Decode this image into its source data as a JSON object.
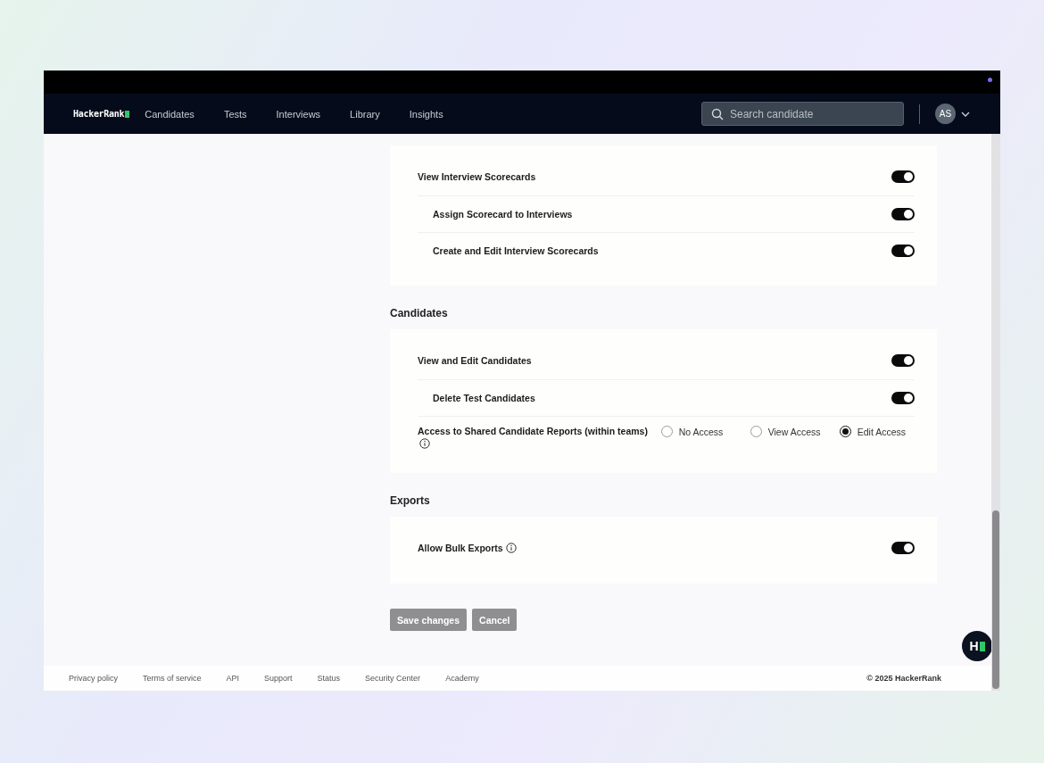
{
  "top_bar": {
    "notification_dot": true
  },
  "nav": {
    "logo": "HackerRank",
    "items": [
      {
        "label": "Candidates"
      },
      {
        "label": "Tests"
      },
      {
        "label": "Interviews"
      },
      {
        "label": "Library"
      },
      {
        "label": "Insights"
      }
    ],
    "search": {
      "placeholder": "Search candidate"
    },
    "avatar": "AS"
  },
  "sections": [
    {
      "rows": [
        {
          "kind": "toggle",
          "label": "View Interview Scorecards",
          "on": true,
          "children": [
            {
              "kind": "toggle",
              "label": "Assign Scorecard to Interviews",
              "on": true
            },
            {
              "kind": "toggle",
              "label": "Create and Edit Interview Scorecards",
              "on": true
            }
          ]
        }
      ]
    },
    {
      "title": "Candidates",
      "rows": [
        {
          "kind": "toggle",
          "label": "View and Edit Candidates",
          "on": true,
          "children": [
            {
              "kind": "toggle",
              "label": "Delete Test Candidates",
              "on": true
            }
          ]
        },
        {
          "kind": "radio",
          "label": "Access to Shared Candidate Reports (within teams)",
          "info_icon": true,
          "options": [
            {
              "label": "No Access",
              "selected": false
            },
            {
              "label": "View Access",
              "selected": false
            },
            {
              "label": "Edit Access",
              "selected": true
            }
          ]
        }
      ]
    },
    {
      "title": "Exports",
      "rows": [
        {
          "kind": "toggle",
          "label": "Allow Bulk Exports",
          "info_icon": true,
          "on": true
        }
      ]
    }
  ],
  "buttons": [
    {
      "label": "Save changes",
      "disabled": true
    },
    {
      "label": "Cancel",
      "disabled": true
    }
  ],
  "chat_button": "H",
  "footer": {
    "links": [
      "Privacy policy",
      "Terms of service",
      "API",
      "Support",
      "Status",
      "Security Center",
      "Academy"
    ],
    "copyright": "© 2025 HackerRank"
  }
}
